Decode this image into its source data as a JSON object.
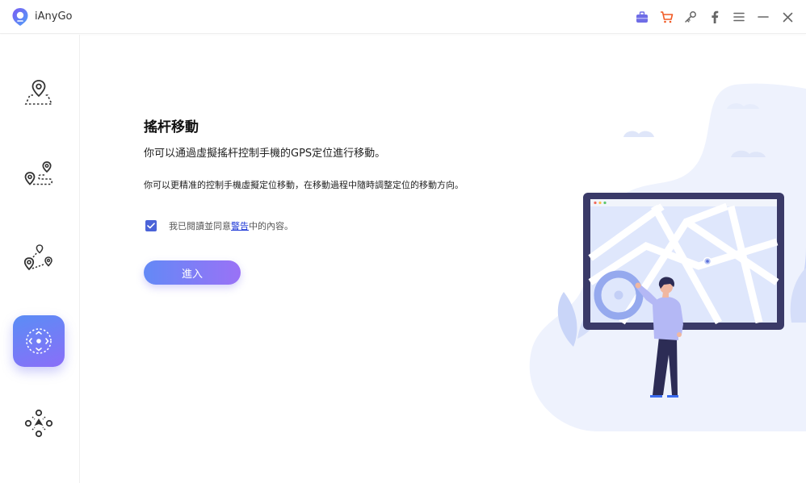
{
  "app": {
    "name": "iAnyGo"
  },
  "titlebar": {
    "icons": [
      "toolbox-icon",
      "cart-icon",
      "key-icon",
      "facebook-icon",
      "menu-icon",
      "minimize-icon",
      "close-icon"
    ]
  },
  "sidebar": {
    "items": [
      {
        "name": "change-location",
        "icon": "location-pin-icon",
        "active": false
      },
      {
        "name": "single-spot-movement",
        "icon": "two-spot-route-icon",
        "active": false
      },
      {
        "name": "multi-spot-movement",
        "icon": "multi-spot-route-icon",
        "active": false
      },
      {
        "name": "joystick-movement",
        "icon": "joystick-icon",
        "active": true
      },
      {
        "name": "game-mode",
        "icon": "game-controller-icon",
        "active": false
      }
    ]
  },
  "main": {
    "title": "搖杆移動",
    "subtitle": "你可以通過虛擬搖杆控制手機的GPS定位進行移動。",
    "description": "你可以更精准的控制手機虛擬定位移動，在移動過程中隨時調整定位的移動方向。",
    "agreement": {
      "checked": true,
      "prefix": "我已閱讀並同意",
      "link": "警告",
      "suffix": "中的內容。"
    },
    "enter_label": "進入"
  },
  "colors": {
    "accent_start": "#6389f6",
    "accent_end": "#9a72f6",
    "checkbox": "#4b63d8",
    "link": "#1a35d6"
  }
}
